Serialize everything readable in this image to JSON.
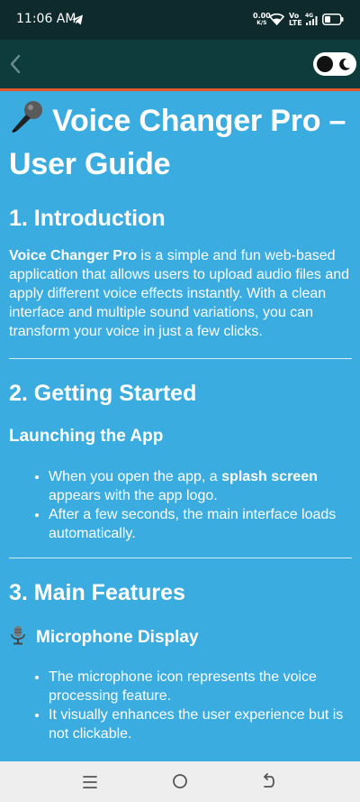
{
  "status_bar": {
    "time": "11:06 AM",
    "speed_value": "0.00",
    "speed_unit": "K/S",
    "volte_top": "Vo",
    "volte_bottom": "LTE",
    "network": "4G",
    "icons": [
      "telegram-icon",
      "wifi-icon",
      "signal-icon",
      "battery-icon"
    ]
  },
  "app_bar": {
    "back_icon": "chevron-left-icon",
    "theme_toggle_icon": "moon-icon"
  },
  "doc": {
    "title": "Voice Changer Pro – User Guide",
    "sections": {
      "intro": {
        "heading": "1. Introduction",
        "bold_lead": "Voice Changer Pro",
        "text": " is a simple and fun web-based application that allows users to upload audio files and apply different voice effects instantly. With a clean interface and multiple sound variations, you can transform your voice in just a few clicks."
      },
      "getting_started": {
        "heading": "2. Getting Started",
        "subheading": "Launching the App",
        "bullet1_pre": "When you open the app, a ",
        "bullet1_bold": "splash screen",
        "bullet1_post": " appears with the app logo.",
        "bullet2": "After a few seconds, the main interface loads automatically."
      },
      "features": {
        "heading": "3. Main Features",
        "subheading": "Microphone Display",
        "bullet1": "The microphone icon represents the voice processing feature.",
        "bullet2": "It visually enhances the user experience but is not clickable."
      }
    }
  },
  "nav_bar": {
    "icons": [
      "menu-icon",
      "home-icon",
      "back-icon"
    ]
  },
  "colors": {
    "page_bg": "#3aace0",
    "app_bar_bg": "#0e3c3d",
    "status_bar_bg": "#0e2a2c",
    "accent_line": "#e3592c",
    "nav_bar_bg": "#eeeeee"
  }
}
